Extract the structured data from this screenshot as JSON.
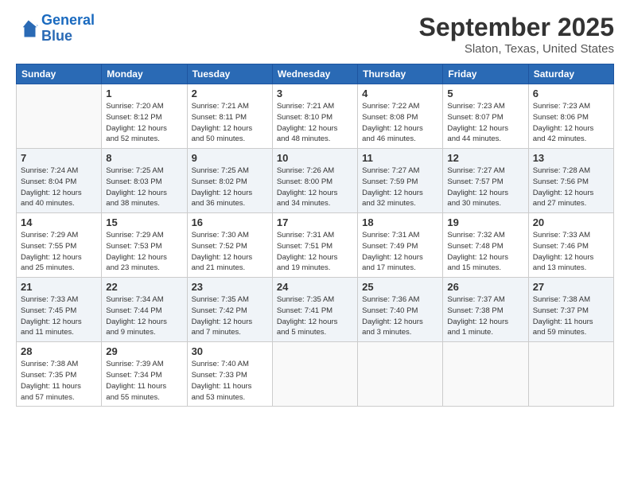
{
  "logo": {
    "line1": "General",
    "line2": "Blue"
  },
  "title": "September 2025",
  "location": "Slaton, Texas, United States",
  "days_header": [
    "Sunday",
    "Monday",
    "Tuesday",
    "Wednesday",
    "Thursday",
    "Friday",
    "Saturday"
  ],
  "weeks": [
    [
      {
        "num": "",
        "info": ""
      },
      {
        "num": "1",
        "info": "Sunrise: 7:20 AM\nSunset: 8:12 PM\nDaylight: 12 hours\nand 52 minutes."
      },
      {
        "num": "2",
        "info": "Sunrise: 7:21 AM\nSunset: 8:11 PM\nDaylight: 12 hours\nand 50 minutes."
      },
      {
        "num": "3",
        "info": "Sunrise: 7:21 AM\nSunset: 8:10 PM\nDaylight: 12 hours\nand 48 minutes."
      },
      {
        "num": "4",
        "info": "Sunrise: 7:22 AM\nSunset: 8:08 PM\nDaylight: 12 hours\nand 46 minutes."
      },
      {
        "num": "5",
        "info": "Sunrise: 7:23 AM\nSunset: 8:07 PM\nDaylight: 12 hours\nand 44 minutes."
      },
      {
        "num": "6",
        "info": "Sunrise: 7:23 AM\nSunset: 8:06 PM\nDaylight: 12 hours\nand 42 minutes."
      }
    ],
    [
      {
        "num": "7",
        "info": "Sunrise: 7:24 AM\nSunset: 8:04 PM\nDaylight: 12 hours\nand 40 minutes."
      },
      {
        "num": "8",
        "info": "Sunrise: 7:25 AM\nSunset: 8:03 PM\nDaylight: 12 hours\nand 38 minutes."
      },
      {
        "num": "9",
        "info": "Sunrise: 7:25 AM\nSunset: 8:02 PM\nDaylight: 12 hours\nand 36 minutes."
      },
      {
        "num": "10",
        "info": "Sunrise: 7:26 AM\nSunset: 8:00 PM\nDaylight: 12 hours\nand 34 minutes."
      },
      {
        "num": "11",
        "info": "Sunrise: 7:27 AM\nSunset: 7:59 PM\nDaylight: 12 hours\nand 32 minutes."
      },
      {
        "num": "12",
        "info": "Sunrise: 7:27 AM\nSunset: 7:57 PM\nDaylight: 12 hours\nand 30 minutes."
      },
      {
        "num": "13",
        "info": "Sunrise: 7:28 AM\nSunset: 7:56 PM\nDaylight: 12 hours\nand 27 minutes."
      }
    ],
    [
      {
        "num": "14",
        "info": "Sunrise: 7:29 AM\nSunset: 7:55 PM\nDaylight: 12 hours\nand 25 minutes."
      },
      {
        "num": "15",
        "info": "Sunrise: 7:29 AM\nSunset: 7:53 PM\nDaylight: 12 hours\nand 23 minutes."
      },
      {
        "num": "16",
        "info": "Sunrise: 7:30 AM\nSunset: 7:52 PM\nDaylight: 12 hours\nand 21 minutes."
      },
      {
        "num": "17",
        "info": "Sunrise: 7:31 AM\nSunset: 7:51 PM\nDaylight: 12 hours\nand 19 minutes."
      },
      {
        "num": "18",
        "info": "Sunrise: 7:31 AM\nSunset: 7:49 PM\nDaylight: 12 hours\nand 17 minutes."
      },
      {
        "num": "19",
        "info": "Sunrise: 7:32 AM\nSunset: 7:48 PM\nDaylight: 12 hours\nand 15 minutes."
      },
      {
        "num": "20",
        "info": "Sunrise: 7:33 AM\nSunset: 7:46 PM\nDaylight: 12 hours\nand 13 minutes."
      }
    ],
    [
      {
        "num": "21",
        "info": "Sunrise: 7:33 AM\nSunset: 7:45 PM\nDaylight: 12 hours\nand 11 minutes."
      },
      {
        "num": "22",
        "info": "Sunrise: 7:34 AM\nSunset: 7:44 PM\nDaylight: 12 hours\nand 9 minutes."
      },
      {
        "num": "23",
        "info": "Sunrise: 7:35 AM\nSunset: 7:42 PM\nDaylight: 12 hours\nand 7 minutes."
      },
      {
        "num": "24",
        "info": "Sunrise: 7:35 AM\nSunset: 7:41 PM\nDaylight: 12 hours\nand 5 minutes."
      },
      {
        "num": "25",
        "info": "Sunrise: 7:36 AM\nSunset: 7:40 PM\nDaylight: 12 hours\nand 3 minutes."
      },
      {
        "num": "26",
        "info": "Sunrise: 7:37 AM\nSunset: 7:38 PM\nDaylight: 12 hours\nand 1 minute."
      },
      {
        "num": "27",
        "info": "Sunrise: 7:38 AM\nSunset: 7:37 PM\nDaylight: 11 hours\nand 59 minutes."
      }
    ],
    [
      {
        "num": "28",
        "info": "Sunrise: 7:38 AM\nSunset: 7:35 PM\nDaylight: 11 hours\nand 57 minutes."
      },
      {
        "num": "29",
        "info": "Sunrise: 7:39 AM\nSunset: 7:34 PM\nDaylight: 11 hours\nand 55 minutes."
      },
      {
        "num": "30",
        "info": "Sunrise: 7:40 AM\nSunset: 7:33 PM\nDaylight: 11 hours\nand 53 minutes."
      },
      {
        "num": "",
        "info": ""
      },
      {
        "num": "",
        "info": ""
      },
      {
        "num": "",
        "info": ""
      },
      {
        "num": "",
        "info": ""
      }
    ]
  ]
}
